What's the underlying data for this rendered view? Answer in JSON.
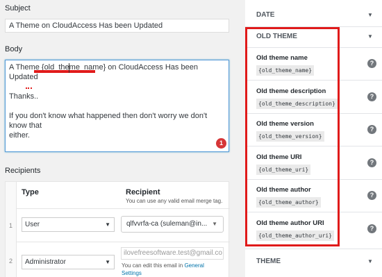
{
  "subject": {
    "label": "Subject",
    "value": "A Theme on CloudAccess Has been Updated"
  },
  "body": {
    "label": "Body",
    "line1_prefix": "A Theme ",
    "line1_tag": "{old_theme_name}",
    "line1_suffix": " on CloudAccess Has been Updated",
    "line2": "Thanks..",
    "line3": "If you don't know what happened then don't worry we don't know that",
    "line4": "either.",
    "badge": "1"
  },
  "recipients": {
    "label": "Recipients",
    "col_type": "Type",
    "col_recipient": "Recipient",
    "col_recipient_help": "You can use any valid email merge tag.",
    "rows": [
      {
        "num": "1",
        "type": "User",
        "recipient": "qlfvvrfa-ca (suleman@in..."
      },
      {
        "num": "2",
        "type": "Administrator",
        "recipient": "ilovefreesoftware.test@gmail.co"
      }
    ],
    "admin_help_prefix": "You can edit this email in ",
    "admin_help_link": "General Settings"
  },
  "sidebar": {
    "sections": [
      {
        "title": "DATE"
      },
      {
        "title": "OLD THEME"
      },
      {
        "title": "THEME"
      }
    ],
    "old_theme_items": [
      {
        "title": "Old theme name",
        "tag": "{old_theme_name}"
      },
      {
        "title": "Old theme description",
        "tag": "{old_theme_description}"
      },
      {
        "title": "Old theme version",
        "tag": "{old_theme_version}"
      },
      {
        "title": "Old theme URI",
        "tag": "{old_theme_uri}"
      },
      {
        "title": "Old theme author",
        "tag": "{old_theme_author}"
      },
      {
        "title": "Old theme author URI",
        "tag": "{old_theme_author_uri}"
      }
    ],
    "help_icon": "?",
    "arrow_icon": "▼"
  },
  "colors": {
    "highlight_red": "#e01a1a",
    "link_blue": "#0073aa",
    "focus_blue": "#5b9dd9"
  }
}
